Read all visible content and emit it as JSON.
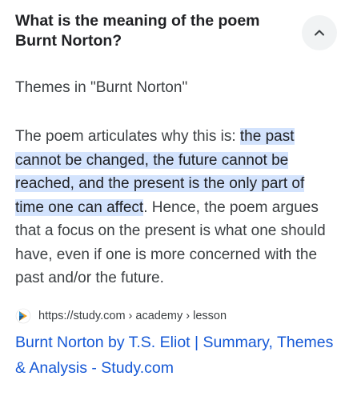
{
  "question": {
    "text": "What is the meaning of the poem Burnt Norton?"
  },
  "collapse_button": {
    "icon": "chevron-up-icon"
  },
  "answer": {
    "heading": "Themes in \"Burnt Norton\"",
    "intro": "The poem articulates why this is: ",
    "highlighted": "the past cannot be changed, the future cannot be reached, and the present is the only part of time one can affect",
    "rest": ". Hence, the poem argues that a focus on the present is what one should have, even if one is more concerned with the past and/or the future."
  },
  "source": {
    "favicon": "study-com-logo-icon",
    "url": "https://study.com › academy › lesson",
    "link_title": "Burnt Norton by T.S. Eliot | Summary, Themes & Analysis - Study.com"
  },
  "colors": {
    "highlight": "#d3e3fd",
    "link": "#1558d6",
    "text": "#202124"
  }
}
